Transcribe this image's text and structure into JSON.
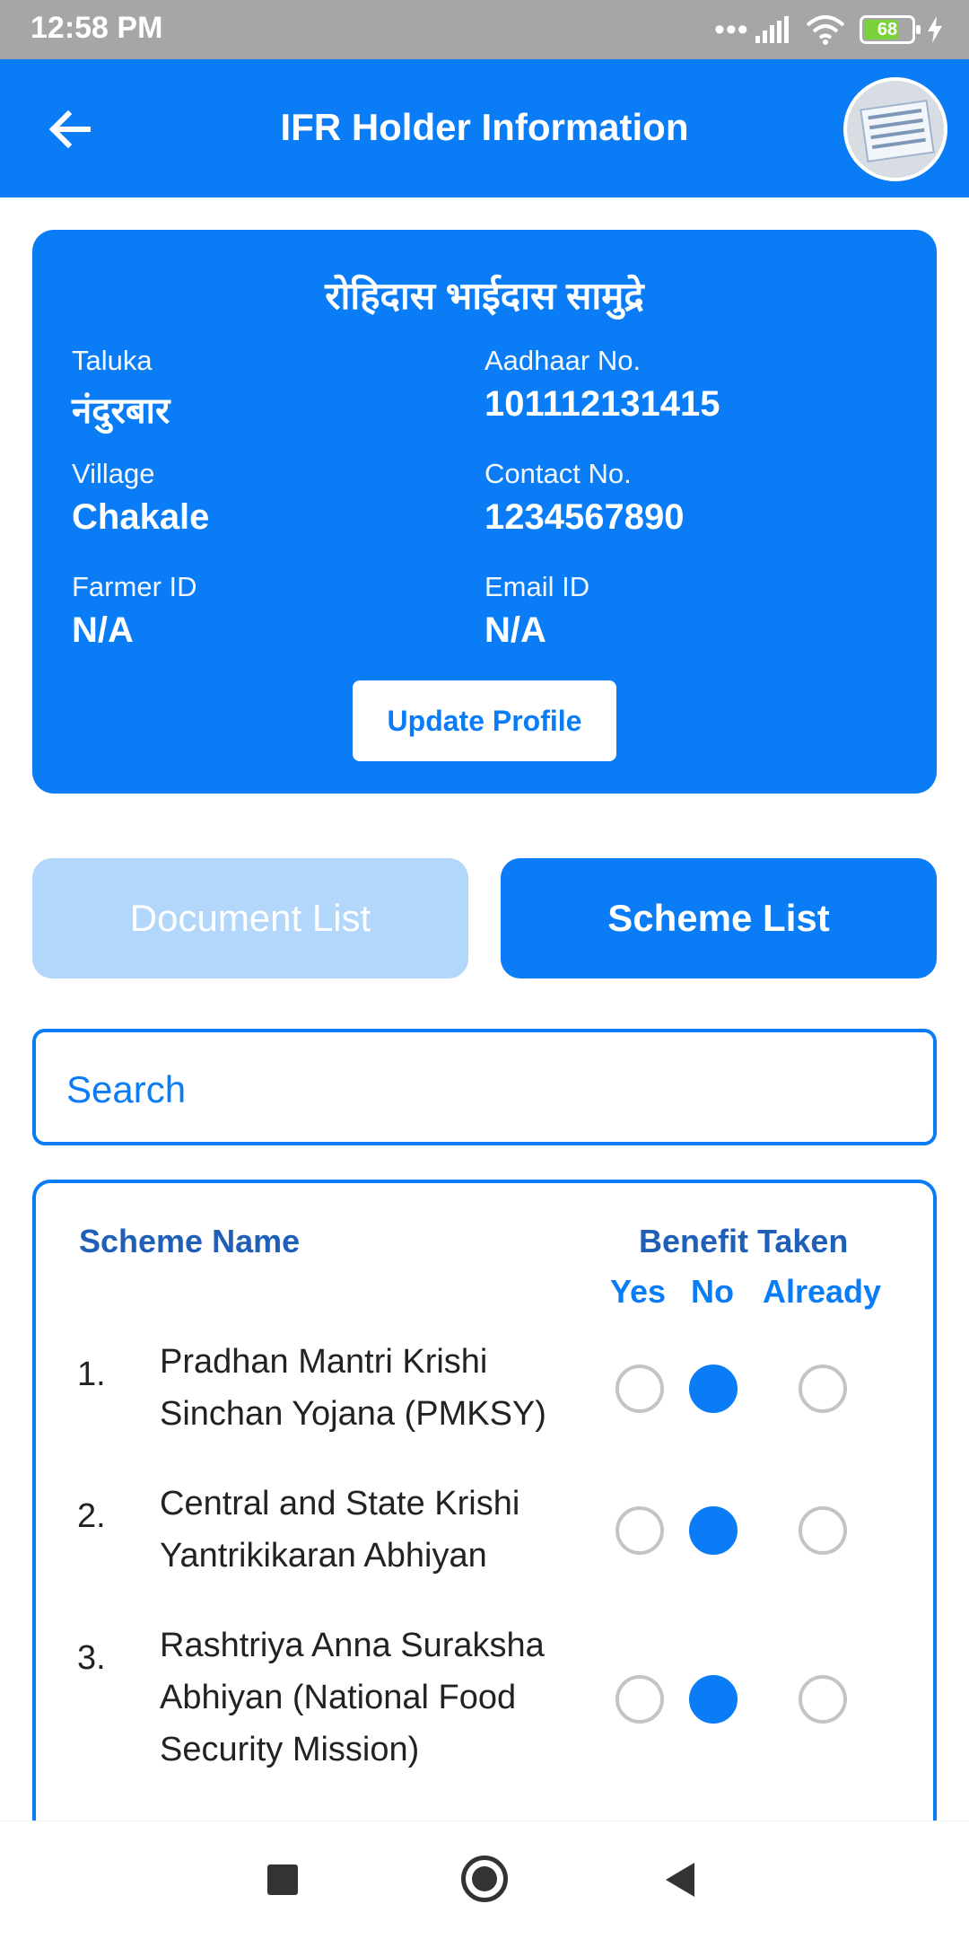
{
  "status_bar": {
    "time": "12:58 PM",
    "battery": "68"
  },
  "app_bar": {
    "title": "IFR Holder Information"
  },
  "profile": {
    "name": "रोहिदास भाईदास सामुद्रे",
    "taluka_label": "Taluka",
    "taluka": "नंदुरबार",
    "aadhaar_label": "Aadhaar No.",
    "aadhaar": "101112131415",
    "village_label": "Village",
    "village": "Chakale",
    "contact_label": "Contact No.",
    "contact": "1234567890",
    "farmer_id_label": "Farmer ID",
    "farmer_id": "N/A",
    "email_label": "Email ID",
    "email": "N/A",
    "update_button": "Update Profile"
  },
  "tabs": {
    "document_list": "Document List",
    "scheme_list": "Scheme List"
  },
  "search": {
    "placeholder": "Search"
  },
  "schemes": {
    "header_name": "Scheme Name",
    "header_benefit": "Benefit Taken",
    "options": [
      "Yes",
      "No",
      "Already"
    ],
    "items": [
      {
        "number": "1.",
        "name": "Pradhan Mantri Krishi Sinchan Yojana (PMKSY)",
        "selected": "No"
      },
      {
        "number": "2.",
        "name": "Central and State Krishi Yantrikikaran Abhiyan",
        "selected": "No"
      },
      {
        "number": "3.",
        "name": "Rashtriya Anna Suraksha Abhiyan (National Food Security Mission)",
        "selected": "No"
      }
    ]
  },
  "colors": {
    "primary": "#0a7cf6",
    "tab_inactive": "#b3d7fb",
    "header_text": "#1f5fb8"
  }
}
